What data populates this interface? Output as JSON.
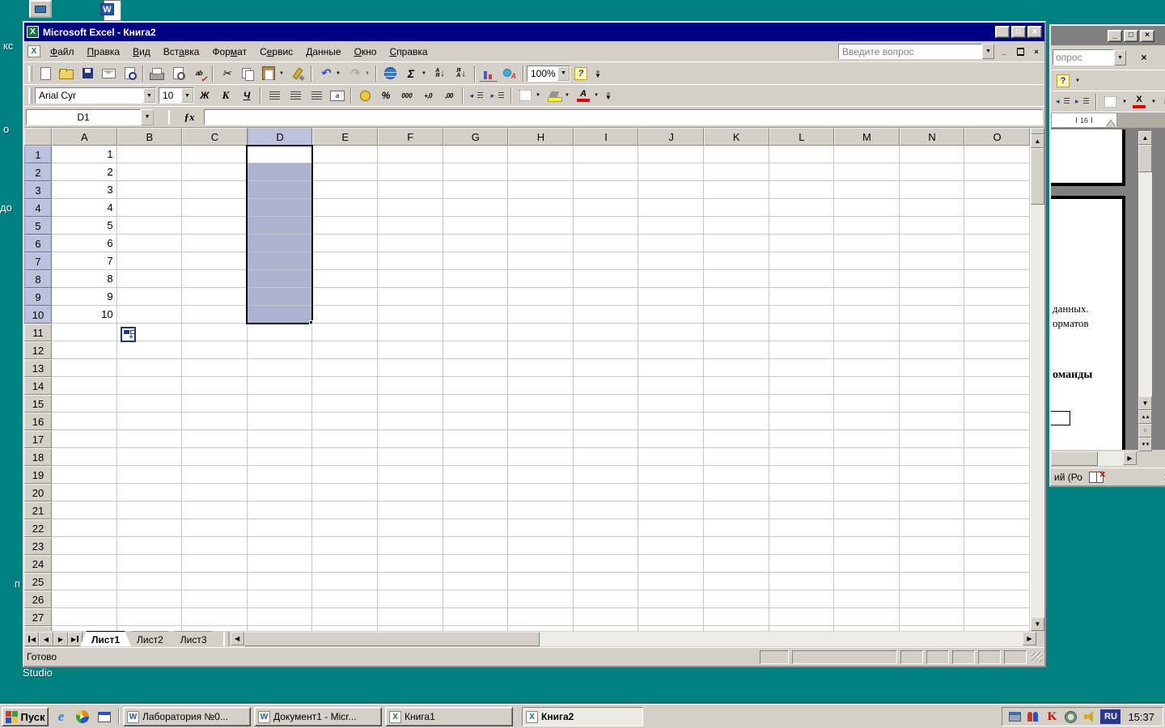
{
  "colors": {
    "desktop": "#008080",
    "titlebar": "#000082",
    "sel": "#ACB3CE",
    "hdrsel": "#BCC2DB",
    "rubadge": "#283593"
  },
  "icons": {
    "minimize": "_",
    "maximize": "□",
    "close": "×",
    "dropdown": "▼",
    "up": "▲",
    "down": "▼",
    "left": "◀",
    "right": "▶",
    "fx": "ƒx",
    "word": "W",
    "excel": "X",
    "kaspersky": "K",
    "ie": "e",
    "play": "▶",
    "plus": "+",
    "dbl_up": "▲▲",
    "dbl_down": "▼▼",
    "circle": "○",
    "chevron": "»"
  },
  "desktop": {
    "fragments": [
      "кс",
      "о",
      "до",
      "п"
    ],
    "studio": "Studio"
  },
  "excel": {
    "title": "Microsoft Excel - Книга2",
    "menu": [
      {
        "label": "Файл",
        "u": 0
      },
      {
        "label": "Правка",
        "u": 0
      },
      {
        "label": "Вид",
        "u": 0
      },
      {
        "label": "Вставка",
        "u": 3
      },
      {
        "label": "Формат",
        "u": 3
      },
      {
        "label": "Сервис",
        "u": 1
      },
      {
        "label": "Данные",
        "u": 0
      },
      {
        "label": "Окно",
        "u": 0
      },
      {
        "label": "Справка",
        "u": 0
      }
    ],
    "question_placeholder": "Введите вопрос",
    "std_toolbar": [
      {
        "name": "new"
      },
      {
        "name": "open"
      },
      {
        "name": "save"
      },
      {
        "name": "mail"
      },
      {
        "name": "search"
      },
      {
        "sep": true
      },
      {
        "name": "print"
      },
      {
        "name": "print-preview"
      },
      {
        "name": "spelling",
        "glyph": "ab"
      },
      {
        "sep": true
      },
      {
        "name": "cut",
        "glyph": "✂"
      },
      {
        "name": "copy"
      },
      {
        "name": "paste",
        "dd": true
      },
      {
        "name": "format-painter"
      },
      {
        "sep": true
      },
      {
        "name": "undo",
        "glyph": "↶",
        "dd": true
      },
      {
        "name": "redo",
        "glyph": "↷",
        "dd": true,
        "disabled": true
      },
      {
        "sep": true
      },
      {
        "name": "hyperlink"
      },
      {
        "name": "autosum",
        "glyph": "Σ",
        "dd": true
      },
      {
        "name": "sort-asc",
        "letters": "А\nЯ",
        "arrow": "↓"
      },
      {
        "name": "sort-desc",
        "letters": "Я\nА",
        "arrow": "↓"
      },
      {
        "sep": true
      },
      {
        "name": "chart-wizard"
      },
      {
        "name": "drawing"
      },
      {
        "sep": true
      },
      {
        "name": "zoom",
        "combo": "100%"
      },
      {
        "name": "help"
      },
      {
        "name": "toolbar-options",
        "chev": true
      }
    ],
    "fmt_toolbar": {
      "font_name": "Arial Cyr",
      "font_size": "10",
      "items": [
        {
          "name": "bold",
          "glyph": "Ж"
        },
        {
          "name": "italic",
          "glyph": "К"
        },
        {
          "name": "underline",
          "glyph": "Ч"
        },
        {
          "sep": true
        },
        {
          "name": "align-left"
        },
        {
          "name": "align-center"
        },
        {
          "name": "align-right"
        },
        {
          "name": "merge-center"
        },
        {
          "sep": true
        },
        {
          "name": "currency"
        },
        {
          "name": "percent",
          "glyph": "%"
        },
        {
          "name": "thousands",
          "glyph": "000"
        },
        {
          "name": "increase-decimal",
          "glyph": "+,0"
        },
        {
          "name": "decrease-decimal",
          "glyph": ",00"
        },
        {
          "sep": true
        },
        {
          "name": "decrease-indent"
        },
        {
          "name": "increase-indent"
        },
        {
          "sep": true
        },
        {
          "name": "borders",
          "dd": true
        },
        {
          "name": "fill-color",
          "dd": true
        },
        {
          "name": "font-color",
          "glyph": "А",
          "dd": true
        },
        {
          "name": "toolbar-options",
          "chev": true
        }
      ]
    },
    "name_box": "D1",
    "formula_value": "",
    "grid": {
      "columns": [
        "A",
        "B",
        "C",
        "D",
        "E",
        "F",
        "G",
        "H",
        "I",
        "J",
        "K",
        "L",
        "M",
        "N",
        "O"
      ],
      "rows": [
        "1",
        "2",
        "3",
        "4",
        "5",
        "6",
        "7",
        "8",
        "9",
        "10",
        "11",
        "12",
        "13",
        "14",
        "15",
        "16",
        "17",
        "18",
        "19",
        "20",
        "21",
        "22",
        "23",
        "24",
        "25",
        "26",
        "27"
      ],
      "col_a_values": [
        "1",
        "2",
        "3",
        "4",
        "5",
        "6",
        "7",
        "8",
        "9",
        "10"
      ],
      "selected_column": "D",
      "selected_row_start": 1,
      "selected_row_end": 10,
      "active_cell": "D1"
    },
    "sheet_tabs": [
      "Лист1",
      "Лист2",
      "Лист3"
    ],
    "active_tab": "Лист1",
    "status": "Готово"
  },
  "word_window": {
    "question_fragment": "опрос",
    "ruler_label": "16",
    "fragments": [
      "данных.",
      "орматов",
      "оманды"
    ],
    "status_fragment": "ий (Ро"
  },
  "taskbar": {
    "start_label": "Пуск",
    "tasks": [
      {
        "label": "Лаборатория №0...",
        "app": "word"
      },
      {
        "label": "Документ1 - Micr...",
        "app": "word"
      },
      {
        "label": "Книга1",
        "app": "excel"
      },
      {
        "label": "Книга2",
        "app": "excel",
        "active": true
      }
    ],
    "tray_icons": [
      "remote-device",
      "contacts",
      "kaspersky",
      "agent",
      "volume"
    ],
    "language": "RU",
    "time": "15:37"
  }
}
